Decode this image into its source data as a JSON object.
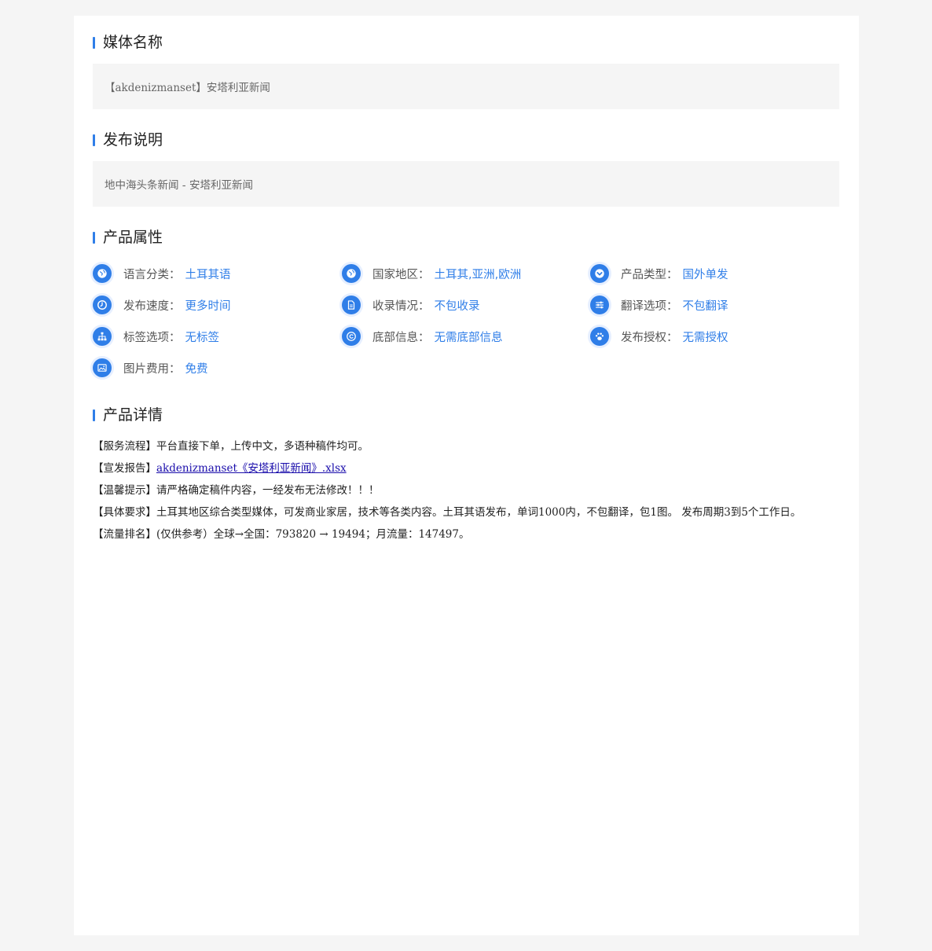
{
  "sections": {
    "media_name": {
      "title": "媒体名称",
      "value": "【akdenizmanset】安塔利亚新闻"
    },
    "publish_desc": {
      "title": "发布说明",
      "value": "地中海头条新闻 - 安塔利亚新闻"
    },
    "attributes": {
      "title": "产品属性",
      "items": [
        {
          "label": "语言分类",
          "value": "土耳其语",
          "icon": "globe-icon"
        },
        {
          "label": "国家地区",
          "value": "土耳其,亚洲,欧洲",
          "icon": "globe-icon"
        },
        {
          "label": "产品类型",
          "value": "国外单发",
          "icon": "chevron-circle-down-icon"
        },
        {
          "label": "发布速度",
          "value": "更多时间",
          "icon": "clock-icon"
        },
        {
          "label": "收录情况",
          "value": "不包收录",
          "icon": "document-icon"
        },
        {
          "label": "翻译选项",
          "value": "不包翻译",
          "icon": "sliders-icon"
        },
        {
          "label": "标签选项",
          "value": "无标签",
          "icon": "sitemap-icon"
        },
        {
          "label": "底部信息",
          "value": "无需底部信息",
          "icon": "copyright-icon"
        },
        {
          "label": "发布授权",
          "value": "无需授权",
          "icon": "paw-icon"
        },
        {
          "label": "图片费用",
          "value": "免费",
          "icon": "image-icon"
        }
      ],
      "colon": "："
    },
    "details": {
      "title": "产品详情",
      "lines": [
        {
          "prefix": "【服务流程】",
          "text": "平台直接下单，上传中文，多语种稿件均可。"
        },
        {
          "prefix": "【宣发报告】",
          "link": "akdenizmanset《安塔利亚新闻》.xlsx"
        },
        {
          "prefix": "【温馨提示】",
          "text": "请严格确定稿件内容，一经发布无法修改！！！"
        },
        {
          "prefix": "【具体要求】",
          "text": "土耳其地区综合类型媒体，可发商业家居，技术等各类内容。土耳其语发布，单词1000内，不包翻译，包1图。 发布周期3到5个工作日。"
        },
        {
          "prefix": "【流量排名】",
          "text": "(仅供参考）全球→全国：793820 → 19494；月流量：147497。"
        }
      ]
    }
  },
  "colors": {
    "accent": "#2f7ee8",
    "page_bg": "#f5f5f5",
    "box_bg": "#f5f5f5",
    "link": "#1a0dab"
  }
}
